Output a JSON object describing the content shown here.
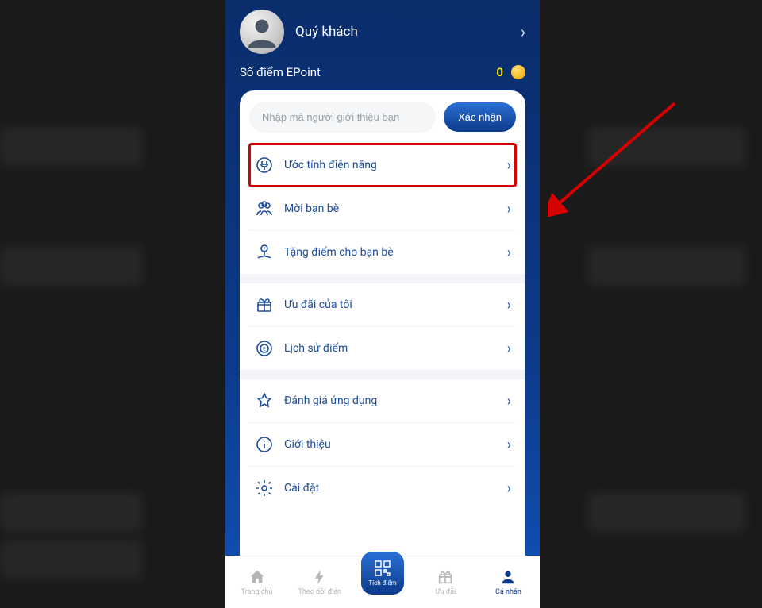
{
  "header": {
    "user_name": "Quý khách",
    "epoint_label": "Số điểm EPoint",
    "epoint_value": "0"
  },
  "referral": {
    "placeholder": "Nhập mã người giới thiệu bạn",
    "confirm_label": "Xác nhận"
  },
  "menu": {
    "section1": [
      {
        "label": "Ước tính điện năng"
      },
      {
        "label": "Mời bạn bè"
      },
      {
        "label": "Tặng điểm cho bạn bè"
      }
    ],
    "section2": [
      {
        "label": "Ưu đãi của tôi"
      },
      {
        "label": "Lịch sử điểm"
      }
    ],
    "section3": [
      {
        "label": "Đánh giá ứng dụng"
      },
      {
        "label": "Giới thiệu"
      },
      {
        "label": "Cài đặt"
      }
    ]
  },
  "nav": {
    "home": "Trang chủ",
    "monitor": "Theo dõi điện",
    "points": "Tích điểm",
    "offers": "Ưu đãi",
    "profile": "Cá nhân"
  }
}
